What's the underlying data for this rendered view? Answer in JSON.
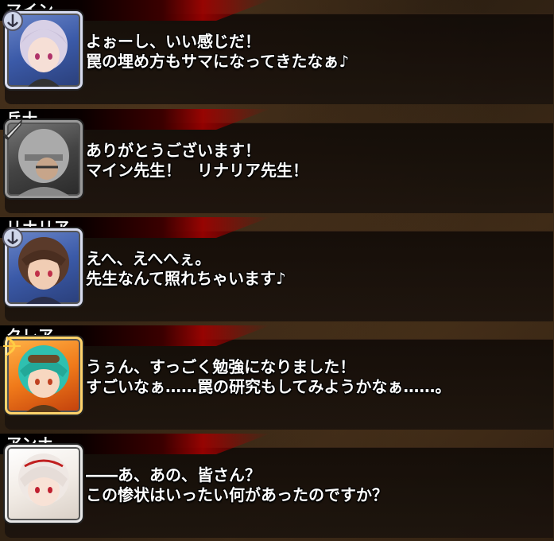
{
  "entries": [
    {
      "speaker": "マイン",
      "line1": "よぉーし、いい感じだ！",
      "line2": "罠の埋め方もサマになってきたなぁ♪",
      "portrait_color": "#3b5aa8",
      "class_icon": "anchor-emblem-icon"
    },
    {
      "speaker": "兵士",
      "line1": "ありがとうございます！",
      "line2": "マイン先生！　リナリア先生！",
      "portrait_color": "#444444",
      "class_icon": "sword-icon"
    },
    {
      "speaker": "リナリア",
      "line1": "えへ、えへへぇ。",
      "line2": "先生なんて照れちゃいます♪",
      "portrait_color": "#3b5aa8",
      "class_icon": "anchor-emblem-icon"
    },
    {
      "speaker": "クレア",
      "line1": "うぅん、すっごく勉強になりました！",
      "line2": "すごいなぁ……罠の研究もしてみようかなぁ……。",
      "portrait_color": "#f07a1a",
      "class_icon": "bow-icon"
    },
    {
      "speaker": "アンナ",
      "line1": "――あ、あの、皆さん？",
      "line2": "この惨状はいったい何があったのですか？",
      "portrait_color": "#f2ece6",
      "class_icon": ""
    }
  ]
}
